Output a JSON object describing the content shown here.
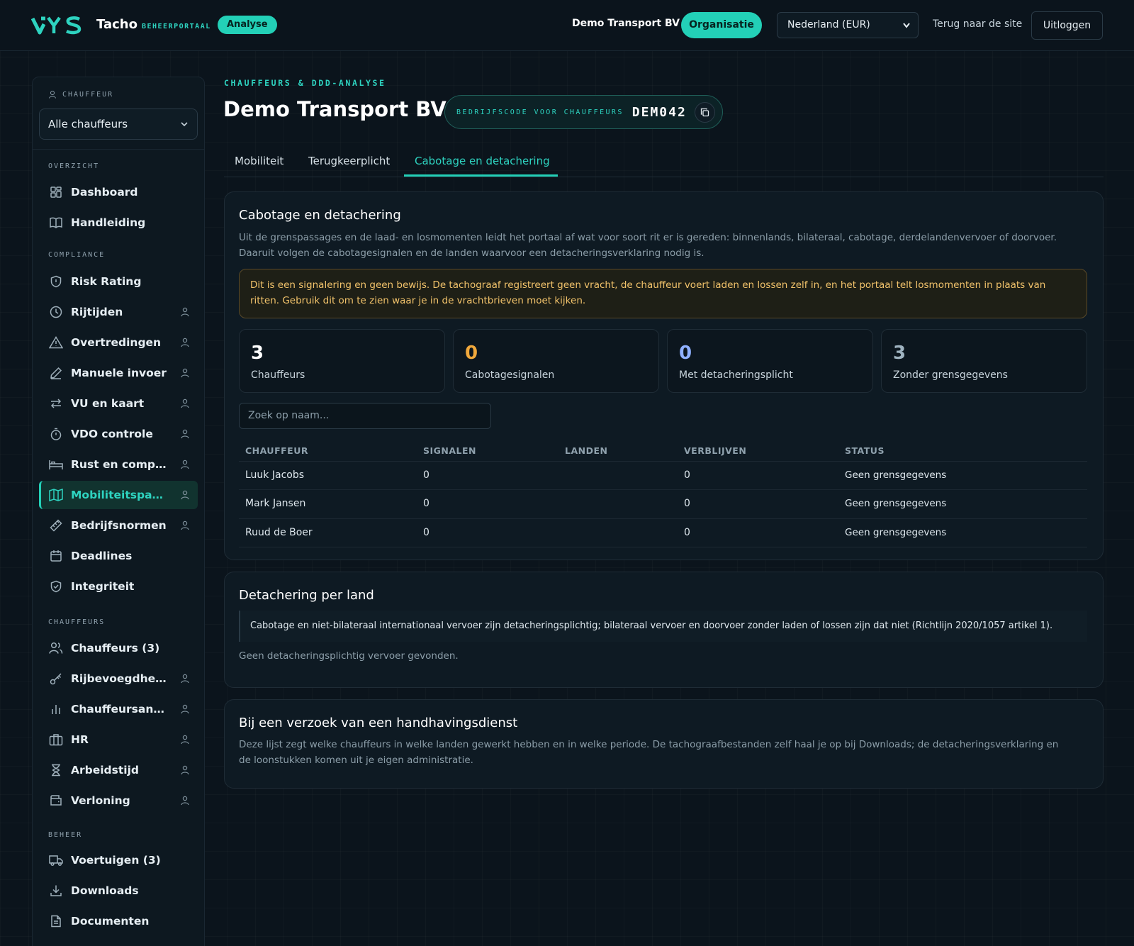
{
  "topbar": {
    "brand_name": "Tacho",
    "brand_sub": "BEHEERPORTAAL",
    "badge": "Analyse",
    "org_name": "Demo Transport BV",
    "org_button": "Organisatie",
    "country_select": "Nederland (EUR)",
    "back_link": "Terug naar de site",
    "logout": "Uitloggen"
  },
  "sidebar": {
    "driver_label": "CHAUFFEUR",
    "driver_select": "Alle chauffeurs",
    "sections": {
      "overzicht": "OVERZICHT",
      "compliance": "COMPLIANCE",
      "chauffeurs": "CHAUFFEURS",
      "beheer": "BEHEER"
    },
    "items": [
      {
        "label": "Dashboard",
        "icon": "grid-icon"
      },
      {
        "label": "Handleiding",
        "icon": "book-icon"
      },
      {
        "label": "Risk Rating",
        "icon": "shield-icon"
      },
      {
        "label": "Rijtijden",
        "icon": "clock-icon"
      },
      {
        "label": "Overtredingen",
        "icon": "warning-icon"
      },
      {
        "label": "Manuele invoer",
        "icon": "pencil-icon"
      },
      {
        "label": "VU en kaart",
        "icon": "swap-icon"
      },
      {
        "label": "VDO controle",
        "icon": "stopwatch-icon"
      },
      {
        "label": "Rust en compen...",
        "icon": "bed-icon"
      },
      {
        "label": "Mobiliteitspakket",
        "icon": "map-icon"
      },
      {
        "label": "Bedrijfsnormen",
        "icon": "ruler-icon"
      },
      {
        "label": "Deadlines",
        "icon": "calendar-icon"
      },
      {
        "label": "Integriteit",
        "icon": "shield-check-icon"
      },
      {
        "label": "Chauffeurs (3)",
        "icon": "users-icon"
      },
      {
        "label": "Rijbevoegdheid",
        "icon": "key-icon"
      },
      {
        "label": "Chauffeursanaly...",
        "icon": "bar-chart-icon"
      },
      {
        "label": "HR",
        "icon": "briefcase-icon"
      },
      {
        "label": "Arbeidstijd",
        "icon": "hourglass-icon"
      },
      {
        "label": "Verloning",
        "icon": "wallet-icon"
      },
      {
        "label": "Voertuigen (3)",
        "icon": "truck-icon"
      },
      {
        "label": "Downloads",
        "icon": "download-icon"
      },
      {
        "label": "Documenten",
        "icon": "document-icon"
      }
    ]
  },
  "main": {
    "breadcrumb": "CHAUFFEURS & DDD-ANALYSE",
    "title": "Demo Transport BV",
    "code_label": "BEDRIJFSCODE VOOR CHAUFFEURS",
    "code_value": "DEM042",
    "tabs": [
      "Mobiliteit",
      "Terugkeerplicht",
      "Cabotage en detachering"
    ],
    "cabotage_card": {
      "title": "Cabotage en detachering",
      "description": "Uit de grenspassages en de laad- en losmomenten leidt het portaal af wat voor soort rit er is gereden: binnenlands, bilateraal, cabotage, derdelandenvervoer of doorvoer. Daaruit volgen de cabotagesignalen en de landen waarvoor een detacheringsverklaring nodig is.",
      "warning": "Dit is een signalering en geen bewijs. De tachograaf registreert geen vracht, de chauffeur voert laden en lossen zelf in, en het portaal telt losmomenten in plaats van ritten. Gebruik dit om te zien waar je in de vrachtbrieven moet kijken.",
      "stats": [
        {
          "value": "3",
          "caption": "Chauffeurs",
          "color": "#ffffff"
        },
        {
          "value": "0",
          "caption": "Cabotagesignalen",
          "color": "#f0a83c"
        },
        {
          "value": "0",
          "caption": "Met detacheringsplicht",
          "color": "#8fb0ff"
        },
        {
          "value": "3",
          "caption": "Zonder grensgegevens",
          "color": "#9fb3c0"
        }
      ],
      "search_placeholder": "Zoek op naam...",
      "columns": [
        "CHAUFFEUR",
        "SIGNALEN",
        "LANDEN",
        "VERBLIJVEN",
        "STATUS"
      ],
      "rows": [
        {
          "name": "Luuk Jacobs",
          "signalen": "0",
          "landen": "",
          "verblijven": "0",
          "status": "Geen grensgegevens"
        },
        {
          "name": "Mark Jansen",
          "signalen": "0",
          "landen": "",
          "verblijven": "0",
          "status": "Geen grensgegevens"
        },
        {
          "name": "Ruud de Boer",
          "signalen": "0",
          "landen": "",
          "verblijven": "0",
          "status": "Geen grensgegevens"
        }
      ]
    },
    "detachering_card": {
      "title": "Detachering per land",
      "note": "Cabotage en niet-bilateraal internationaal vervoer zijn detacheringsplichtig; bilateraal vervoer en doorvoer zonder laden of lossen zijn dat niet (Richtlijn 2020/1057 artikel 1).",
      "empty": "Geen detacheringsplichtig vervoer gevonden."
    },
    "handhaving_card": {
      "title": "Bij een verzoek van een handhavingsdienst",
      "description": "Deze lijst zegt welke chauffeurs in welke landen gewerkt hebben en in welke periode. De tachograafbestanden zelf haal je op bij Downloads; de detacheringsverklaring en de loonstukken komen uit je eigen administratie."
    }
  },
  "colors": {
    "accent": "#23d0b7",
    "background": "#0b141c",
    "warning_text": "#f2c36b"
  }
}
